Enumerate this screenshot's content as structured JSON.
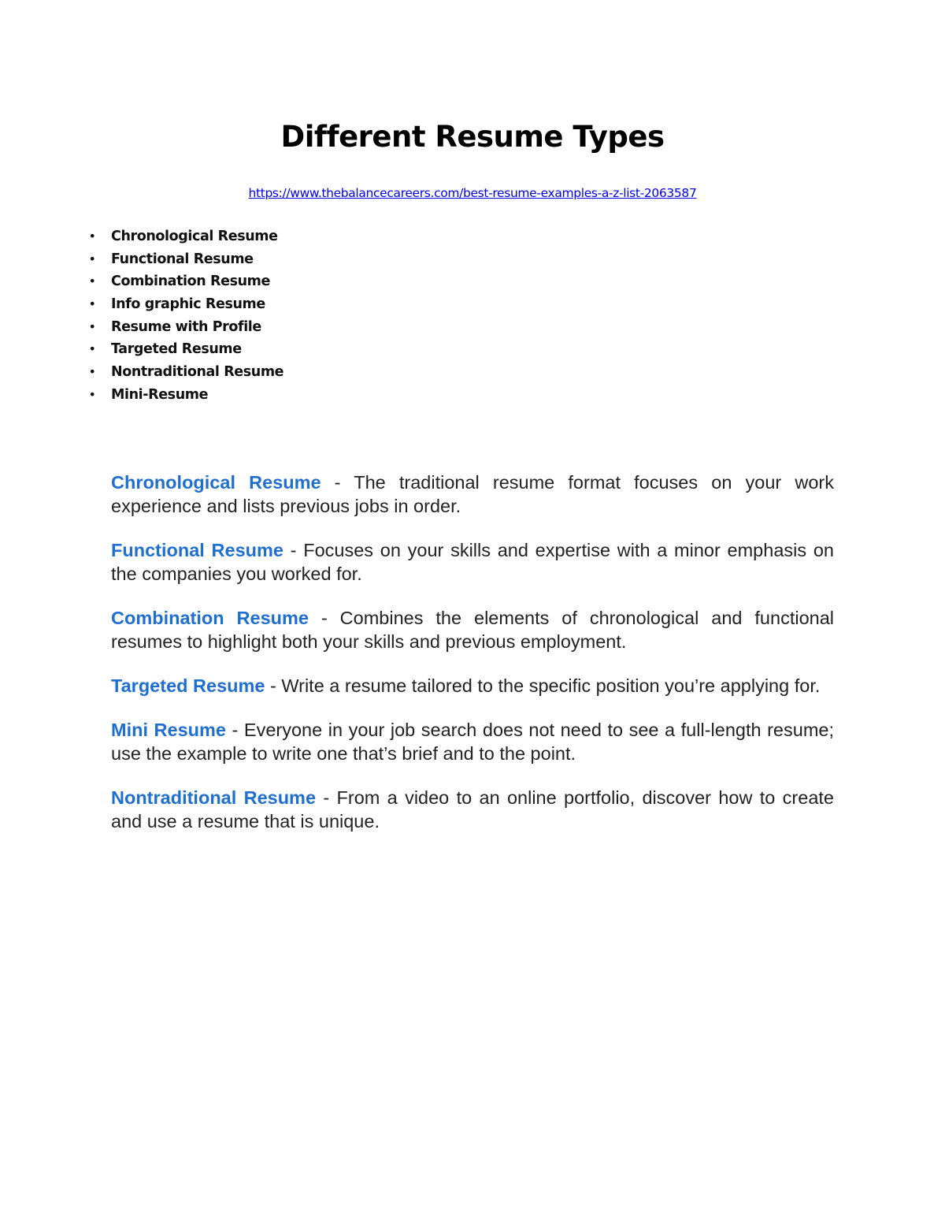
{
  "document": {
    "title": "Different Resume Types",
    "source_link": "https://www.thebalancecareers.com/best-resume-examples-a-z-list-2063587",
    "bullet_glyph": "•",
    "resume_types": [
      "Chronological Resume",
      "Functional Resume",
      "Combination Resume",
      "Info graphic Resume",
      "Resume with Profile",
      "Targeted Resume",
      "Nontraditional Resume",
      "Mini-Resume"
    ],
    "descriptions": [
      {
        "term": "Chronological Resume",
        "separator": " - ",
        "text": "The traditional resume format focuses on your work experience and lists previous jobs in order."
      },
      {
        "term": "Functional Resume",
        "separator": " - ",
        "text": "Focuses on your skills and expertise with a minor emphasis on the companies you worked for."
      },
      {
        "term": "Combination Resume",
        "separator": " - ",
        "text": "Combines the elements of chronological and functional resumes to highlight both your skills and previous employment."
      },
      {
        "term": "Targeted Resume",
        "separator": " - ",
        "text": "Write a resume tailored to the specific position you’re applying for."
      },
      {
        "term": "Mini Resume",
        "separator": " - ",
        "text": "Everyone in your job search does not need to see a full-length resume; use the example to write one that’s brief and to the point."
      },
      {
        "term": "Nontraditional Resume",
        "separator": " - ",
        "text": "From a video to an online portfolio, discover how to create and use a resume that is unique."
      }
    ]
  },
  "colors": {
    "term_blue": "#1f6fd1",
    "link_blue": "#0000ee",
    "body_text": "#222222"
  }
}
